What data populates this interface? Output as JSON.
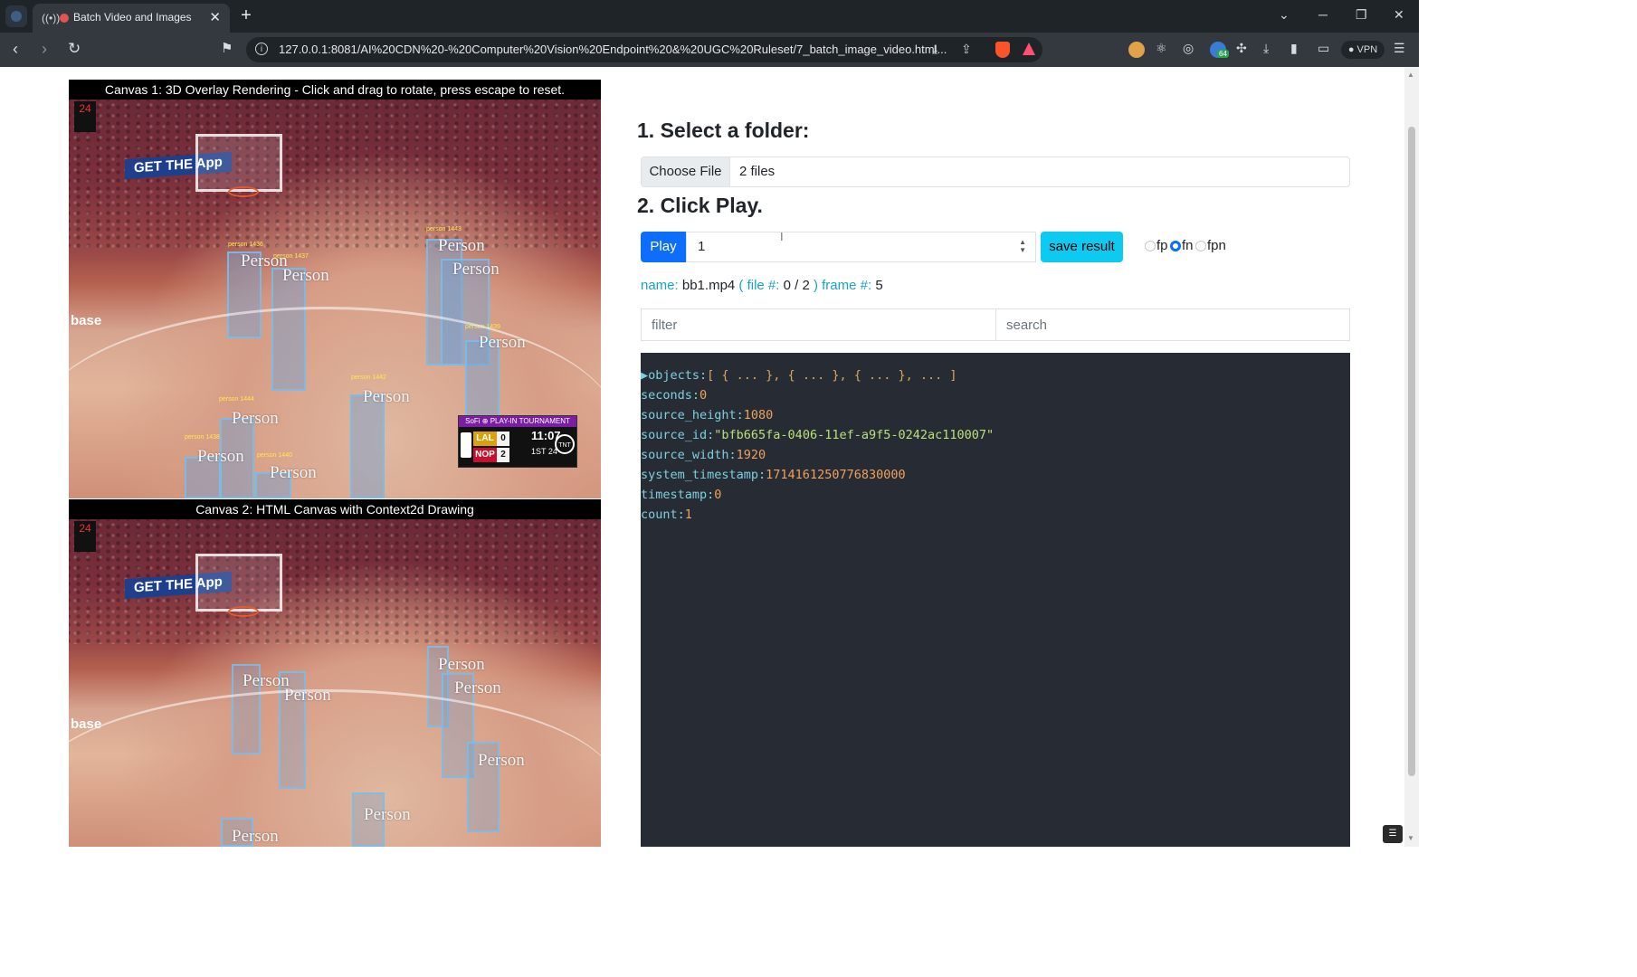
{
  "browser": {
    "tab_title": "Batch Video and Images",
    "url": "127.0.0.1:8081/AI%20CDN%20-%20Computer%20Vision%20Endpoint%20&%20UGC%20Ruleset/7_batch_image_video.html...",
    "vpn_label": "VPN",
    "extension_badge": "64"
  },
  "canvas1": {
    "caption": "Canvas 1: 3D Overlay Rendering - Click and drag to rotate, press escape to reset.",
    "detections": [
      {
        "label": "Person",
        "tag": "person 1436"
      },
      {
        "label": "Person",
        "tag": "person 1437"
      },
      {
        "label": "Person",
        "tag": "person 1443"
      },
      {
        "label": "Person",
        "tag": "person 1441"
      },
      {
        "label": "Person",
        "tag": "person 1439"
      },
      {
        "label": "Person",
        "tag": "person 1442"
      },
      {
        "label": "Person",
        "tag": "person 1444"
      },
      {
        "label": "Person",
        "tag": "person 1438"
      },
      {
        "label": "Person",
        "tag": "person 1440"
      }
    ]
  },
  "canvas2": {
    "caption": "Canvas 2: HTML Canvas with Context2d Drawing",
    "detections": [
      {
        "label": "Person"
      },
      {
        "label": "Person"
      },
      {
        "label": "Person"
      },
      {
        "label": "Person"
      },
      {
        "label": "Person"
      },
      {
        "label": "Person"
      },
      {
        "label": "Person"
      }
    ]
  },
  "scene": {
    "banner": "GET THE App",
    "side_text": "base",
    "scoreboard": {
      "header": "SoFi ⊕ PLAY-IN TOURNAMENT",
      "team1": "LAL",
      "score1": "0",
      "team2": "NOP",
      "score2": "2",
      "clock": "11:07",
      "quarter": "1ST 24",
      "network": "TNT"
    }
  },
  "steps": {
    "step1": "1. Select a folder:",
    "step2": "2. Click Play."
  },
  "file_input": {
    "button_label": "Choose File",
    "value": "2 files"
  },
  "controls": {
    "play_label": "Play",
    "number_value": "1",
    "save_label": "save result",
    "radios": [
      {
        "label": "fp",
        "checked": false
      },
      {
        "label": "fn",
        "checked": true
      },
      {
        "label": "fpn",
        "checked": false
      }
    ]
  },
  "status": {
    "name_key": "name:",
    "name_val": "bb1.mp4",
    "file_key": "( file #:",
    "file_val": "0 / 2",
    "file_close": ")",
    "frame_key": "frame #:",
    "frame_val": "5"
  },
  "filters": {
    "filter_placeholder": "filter",
    "search_placeholder": "search"
  },
  "json_view": {
    "objects_key": "▶objects:",
    "objects_val": "[ { ... }, { ... }, { ... }, ... ]",
    "fields": [
      {
        "key": "seconds:",
        "val": "0",
        "type": "num"
      },
      {
        "key": "source_height:",
        "val": "1080",
        "type": "num"
      },
      {
        "key": "source_id:",
        "val": "\"bfb665fa-0406-11ef-a9f5-0242ac110007\"",
        "type": "str"
      },
      {
        "key": "source_width:",
        "val": "1920",
        "type": "num"
      },
      {
        "key": "system_timestamp:",
        "val": "1714161250776830000",
        "type": "num"
      },
      {
        "key": "timestamp:",
        "val": "0",
        "type": "num"
      },
      {
        "key": "count:",
        "val": "1",
        "type": "num"
      }
    ]
  }
}
